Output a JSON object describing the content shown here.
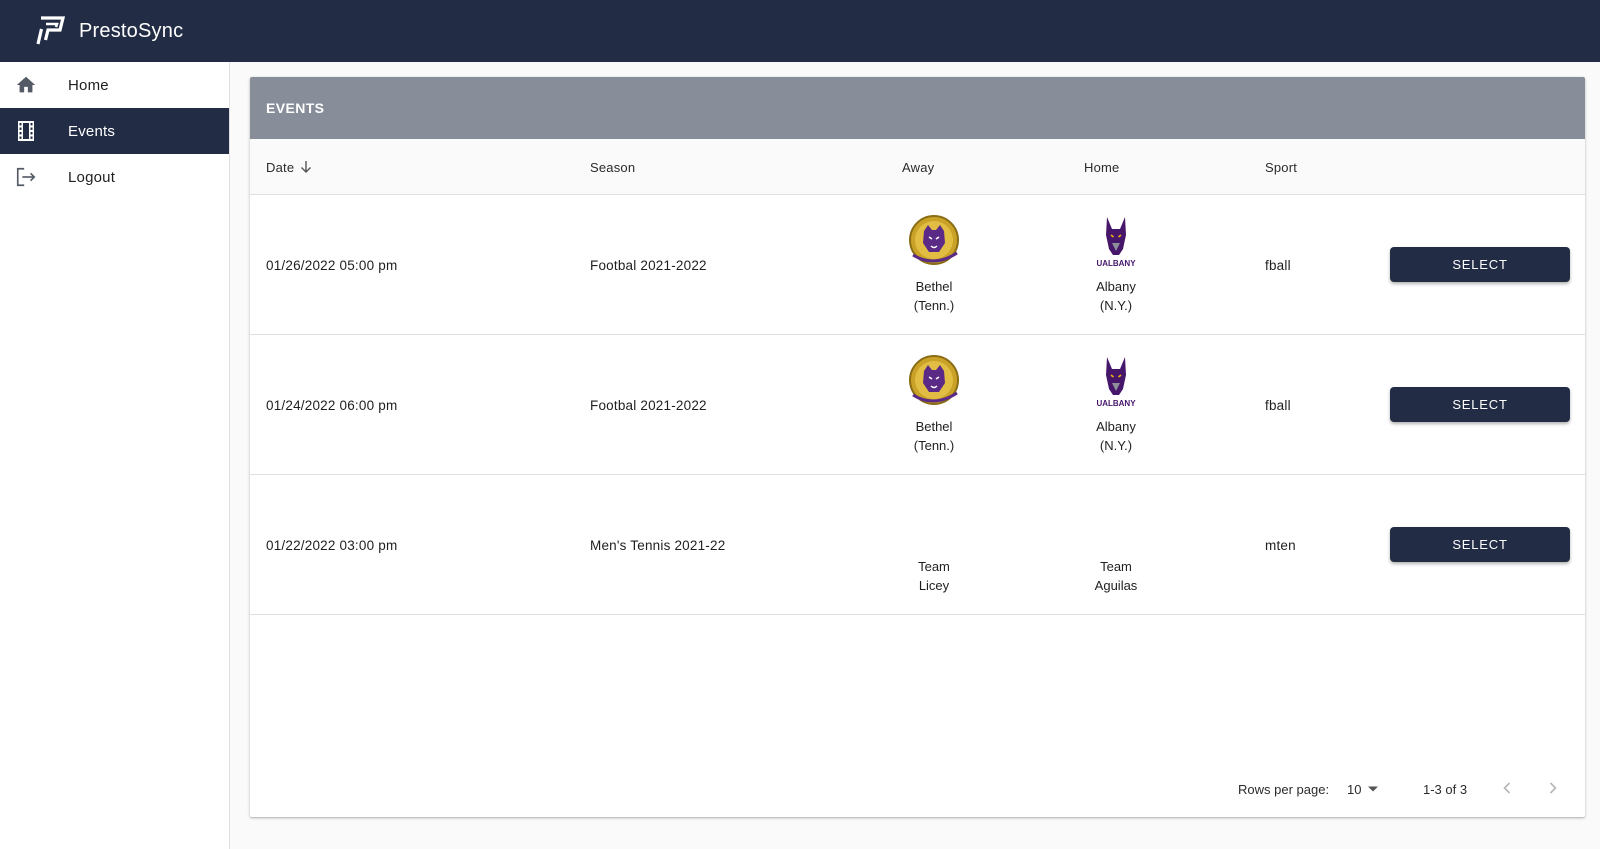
{
  "app": {
    "title": "PrestoSync"
  },
  "sidebar": {
    "items": [
      {
        "label": "Home",
        "icon": "home-icon",
        "active": false
      },
      {
        "label": "Events",
        "icon": "film-icon",
        "active": true
      },
      {
        "label": "Logout",
        "icon": "logout-icon",
        "active": false
      }
    ]
  },
  "events": {
    "title": "EVENTS",
    "columns": {
      "date": "Date",
      "season": "Season",
      "away": "Away",
      "home": "Home",
      "sport": "Sport"
    },
    "sort": {
      "column": "Date",
      "direction": "descending"
    },
    "rows": [
      {
        "date": "01/26/2022 05:00 pm",
        "season": "Footbal 2021-2022",
        "away": "Bethel\n(Tenn.)",
        "away_logo": "bethel-wildcat-logo",
        "home": "Albany\n(N.Y.)",
        "home_logo": "ualbany-great-dane-logo",
        "sport": "fball",
        "action": "SELECT"
      },
      {
        "date": "01/24/2022 06:00 pm",
        "season": "Footbal 2021-2022",
        "away": "Bethel\n(Tenn.)",
        "away_logo": "bethel-wildcat-logo",
        "home": "Albany\n(N.Y.)",
        "home_logo": "ualbany-great-dane-logo",
        "sport": "fball",
        "action": "SELECT"
      },
      {
        "date": "01/22/2022 03:00 pm",
        "season": "Men's Tennis 2021-22",
        "away": "Team\nLicey",
        "away_logo": "",
        "home": "Team\nAguilas",
        "home_logo": "",
        "sport": "mten",
        "action": "SELECT"
      }
    ]
  },
  "pagination": {
    "rows_per_page_label": "Rows per page:",
    "rows_per_page": "10",
    "range": "1-3 of 3"
  },
  "colors": {
    "navy": "#222d45",
    "header_gray": "#878d99",
    "bethel_purple": "#5b2a86",
    "bethel_gold": "#c9a227",
    "ualbany_purple": "#46166b",
    "ualbany_gold": "#eeb211"
  }
}
